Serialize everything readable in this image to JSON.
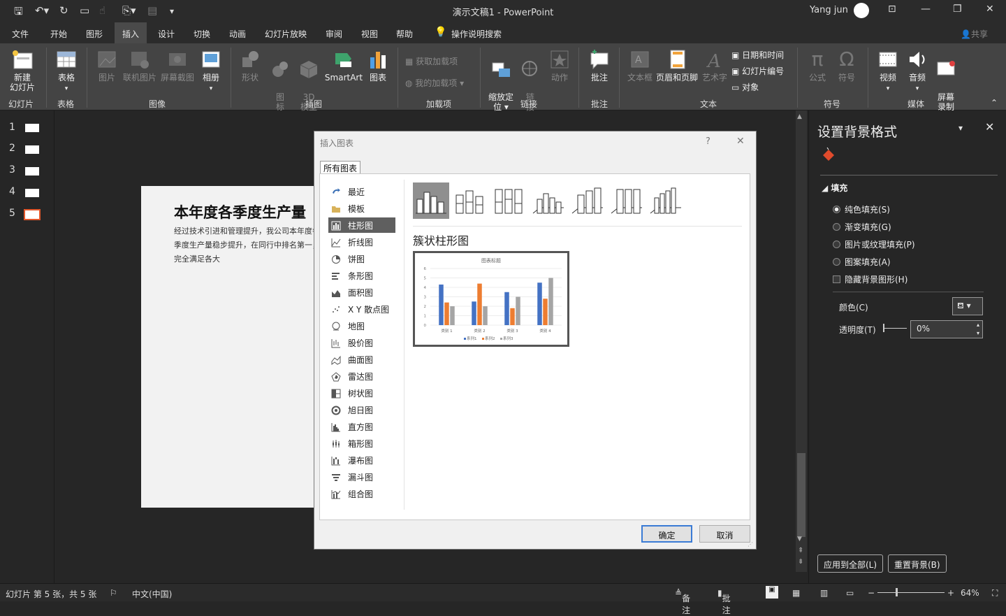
{
  "window": {
    "title": "演示文稿1  -  PowerPoint",
    "user": "Yang jun"
  },
  "tabs": [
    "文件",
    "开始",
    "图形",
    "插入",
    "设计",
    "切换",
    "动画",
    "幻灯片放映",
    "审阅",
    "视图",
    "帮助"
  ],
  "active_tab": "插入",
  "tell_me": "操作说明搜索",
  "share": "共享",
  "ribbon": {
    "new_slide": "新建\n幻灯片",
    "table": "表格",
    "picture": "图片",
    "online_picture": "联机图片",
    "screenshot": "屏幕截图",
    "album": "相册",
    "shapes": "形状",
    "icons": "图\n标",
    "model3d": "3D\n模型",
    "smartart": "SmartArt",
    "chart": "图表",
    "get_addins": "获取加载项",
    "my_addins": "我的加载项",
    "zoom": "缩放定\n位",
    "link": "链\n接",
    "action": "动作",
    "comment": "批注",
    "textbox": "文本框",
    "header_footer": "页眉和页脚",
    "wordart": "艺术字",
    "date_time": "日期和时间",
    "slide_number": "幻灯片编号",
    "object": "对象",
    "equation": "公式",
    "symbol": "符号",
    "video": "视频",
    "audio": "音频",
    "screen_record": "屏幕\n录制",
    "groups": {
      "slides": "幻灯片",
      "tables": "表格",
      "images": "图像",
      "illustrations": "插图",
      "addins": "加载项",
      "links": "链接",
      "comments": "批注",
      "text": "文本",
      "symbols": "符号",
      "media": "媒体"
    }
  },
  "slides": [
    "1",
    "2",
    "3",
    "4",
    "5"
  ],
  "slide": {
    "title": "本年度各季度生产量",
    "body": "经过技术引进和管理提升，我公司本年度各季度生产量稳步提升，在同行中排名第一，完全满足各大"
  },
  "format_pane": {
    "title": "设置背景格式",
    "section": "填充",
    "options": [
      "纯色填充(S)",
      "渐变填充(G)",
      "图片或纹理填充(P)",
      "图案填充(A)"
    ],
    "hide_bg": "隐藏背景图形(H)",
    "color_label": "颜色(C)",
    "transparency_label": "透明度(T)",
    "transparency_value": "0%",
    "apply_all": "应用到全部(L)",
    "reset_bg": "重置背景(B)"
  },
  "dialog": {
    "title": "插入图表",
    "help": "?",
    "tab": "所有图表",
    "chart_types": [
      "最近",
      "模板",
      "柱形图",
      "折线图",
      "饼图",
      "条形图",
      "面积图",
      "X Y 散点图",
      "地图",
      "股价图",
      "曲面图",
      "雷达图",
      "树状图",
      "旭日图",
      "直方图",
      "箱形图",
      "瀑布图",
      "漏斗图",
      "组合图"
    ],
    "selected_type": "柱形图",
    "subtype_name": "簇状柱形图",
    "ok": "确定",
    "cancel": "取消"
  },
  "chart_data": {
    "type": "bar",
    "title": "图表标题",
    "categories": [
      "类别 1",
      "类别 2",
      "类别 3",
      "类别 4"
    ],
    "series": [
      {
        "name": "系列1",
        "values": [
          4.3,
          2.5,
          3.5,
          4.5
        ],
        "color": "#4472c4"
      },
      {
        "name": "系列2",
        "values": [
          2.4,
          4.4,
          1.8,
          2.8
        ],
        "color": "#ed7d31"
      },
      {
        "name": "系列3",
        "values": [
          2,
          2,
          3,
          5
        ],
        "color": "#a5a5a5"
      }
    ],
    "yticks": [
      "0",
      "1",
      "2",
      "3",
      "4",
      "5",
      "6"
    ],
    "ylim": [
      0,
      6
    ],
    "legend": "bottom"
  },
  "status": {
    "slide_info": "幻灯片 第 5 张，共 5 张",
    "language": "中文(中国)",
    "notes": "备注",
    "comments": "批注",
    "zoom": "64%"
  }
}
